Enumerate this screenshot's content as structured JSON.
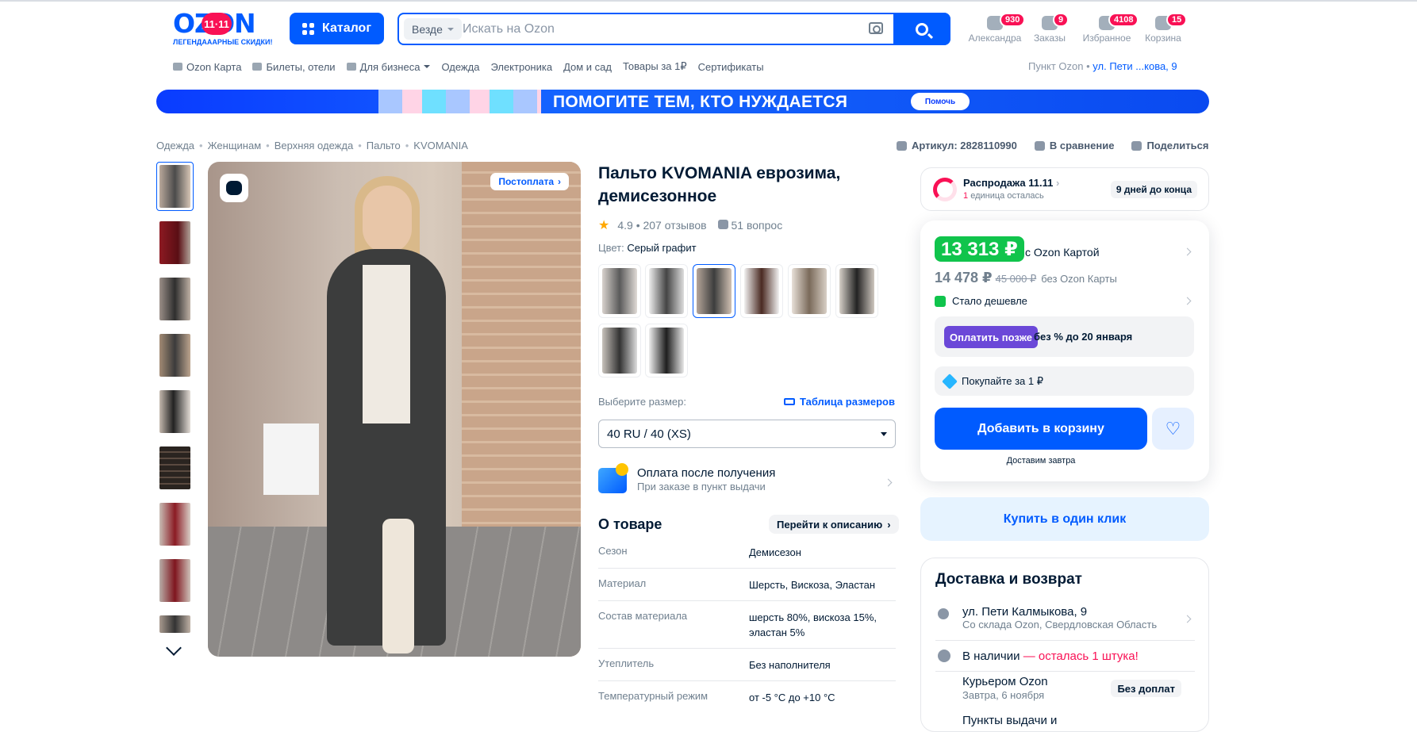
{
  "header": {
    "logo_text": "OZON",
    "logo_badge": "11·11",
    "logo_sub": "ЛЕГЕНДАААРНЫЕ СКИДКИ!",
    "catalog": "Каталог",
    "search": {
      "scope": "Везде",
      "placeholder": "Искать на Ozon"
    },
    "icons": [
      {
        "label": "Александра",
        "count": "930",
        "icon": "user-icon"
      },
      {
        "label": "Заказы",
        "count": "9",
        "icon": "box-icon"
      },
      {
        "label": "Избранное",
        "count": "4108",
        "icon": "heart-icon"
      },
      {
        "label": "Корзина",
        "count": "15",
        "icon": "cart-icon"
      }
    ]
  },
  "nav": {
    "items": [
      "Ozon Карта",
      "Билеты, отели",
      "Для бизнеса",
      "Одежда",
      "Электроника",
      "Дом и сад",
      "Товары за 1₽",
      "Сертификаты"
    ],
    "pickup_label": "Пункт Ozon •",
    "pickup_value": "ул. Пети ...кова, 9"
  },
  "banner": {
    "text": "ПОМОГИТЕ ТЕМ, КТО НУЖДАЕТСЯ",
    "button": "Помочь"
  },
  "breadcrumbs": [
    "Одежда",
    "Женщинам",
    "Верхняя одежда",
    "Пальто",
    "KVOMANIA"
  ],
  "meta": {
    "article": "Артикул: 2828110990",
    "compare": "В сравнение",
    "share": "Поделиться"
  },
  "gallery": {
    "postpay": "Постоплата"
  },
  "product": {
    "title": "Пальто KVOMANIA еврозима, демисезонное",
    "rating": "4.9 • 207 отзывов",
    "questions": "51 вопрос",
    "color_label": "Цвет:",
    "color_value": "Серый графит",
    "size_label": "Выберите размер:",
    "size_table": "Таблица размеров",
    "size_value": "40 RU / 40 (XS)",
    "payafter_title": "Оплата после получения",
    "payafter_sub": "При заказе в пункт выдачи",
    "about": "О товаре",
    "to_desc": "Перейти к описанию",
    "specs": [
      {
        "k": "Сезон",
        "v": "Демисезон"
      },
      {
        "k": "Материал",
        "v": "Шерсть, Вискоза, Эластан"
      },
      {
        "k": "Состав материала",
        "v": "шерсть 80%, вискоза 15%, эластан 5%"
      },
      {
        "k": "Утеплитель",
        "v": "Без наполнителя"
      },
      {
        "k": "Температурный режим",
        "v": "от -5 °C до +10 °C"
      }
    ]
  },
  "buybox": {
    "sale_title": "Распродажа 11.11",
    "sale_left_count": "1",
    "sale_left_text": "единица осталась",
    "sale_days": "9 дней до конца",
    "price_card": "13 313 ₽",
    "price_card_label": "с Ozon Картой",
    "price": "14 478 ₽",
    "price_old": "45 000 ₽",
    "price_label": "без Ozon Карты",
    "cheaper": "Стало дешевле",
    "pay_later_btn": "Оплатить позже",
    "pay_later_text": "без % до 20 января",
    "buy_for_1": "Покупайте за 1 ₽",
    "add_to_cart": "Добавить в корзину",
    "delivery_hint": "Доставим завтра",
    "one_click": "Купить в один клик"
  },
  "delivery": {
    "title": "Доставка и возврат",
    "address": "ул. Пети Калмыкова, 9",
    "warehouse": "Со склада Ozon, Свердловская Область",
    "stock": "В наличии",
    "stock_left": "— осталась 1 штука!",
    "courier": "Курьером Ozon",
    "courier_when": "Завтра, 6 ноября",
    "no_fee": "Без доплат",
    "points": "Пункты выдачи и"
  },
  "colors": {
    "accent": "#005bff",
    "pink": "#f91155",
    "green": "#10c44c",
    "purple": "#6b48d8"
  }
}
